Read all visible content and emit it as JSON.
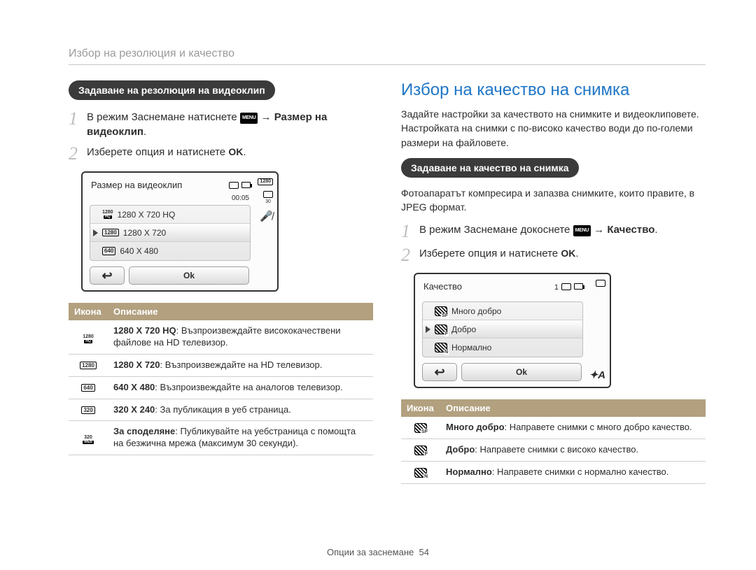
{
  "breadcrumb": "Избор на резолюция и качество",
  "left": {
    "pill": "Задаване на резолюция на видеоклип",
    "step1_pre": "В режим Заснемане натиснете ",
    "menu_badge": "MENU",
    "arrow": " → ",
    "step1_bold": "Размер на видеоклип",
    "step2_pre": "Изберете опция и натиснете ",
    "ok_glyph": "OK",
    "lcd": {
      "title": "Размер на видеоклип",
      "time": "00:05",
      "rows": [
        {
          "icon_top": "1280",
          "icon_sub": "HQ",
          "label": "1280 X 720 HQ"
        },
        {
          "icon_box": "1280",
          "label": "1280 X 720",
          "selected": true
        },
        {
          "icon_box": "640",
          "label": "640 X 480"
        }
      ],
      "back": "↩",
      "ok": "Ok"
    },
    "table": {
      "h1": "Икона",
      "h2": "Описание",
      "rows": [
        {
          "icon_top": "1280",
          "icon_sub": "HQ",
          "bold": "1280 X 720 HQ",
          "rest": ": Възпроизвеждайте висококачествени файлове на HD телевизор."
        },
        {
          "icon_box": "1280",
          "bold": "1280 X 720",
          "rest": ": Възпроизвеждайте на HD телевизор."
        },
        {
          "icon_box": "640",
          "bold": "640 X 480",
          "rest": ": Възпроизвеждайте на аналогов телевизор."
        },
        {
          "icon_box": "320",
          "bold": "320 X 240",
          "rest": ": За публикация в уеб страница."
        },
        {
          "icon_top": "320",
          "icon_sub": "WEB",
          "bold": "За споделяне",
          "rest": ": Публикувайте на уебстраница с помощта на безжична мрежа (максимум 30 секунди)."
        }
      ]
    }
  },
  "right": {
    "heading": "Избор на качество на снимка",
    "intro": "Задайте настройки за качеството на снимките и видеоклиповете. Настройката на снимки с по-високо качество води до по-големи размери на файловете.",
    "pill": "Задаване на качество на снимка",
    "compress": "Фотоапаратът компресира и запазва снимките, които правите, в JPEG формат.",
    "step1_pre": "В режим Заснемане докоснете ",
    "menu_badge": "MENU",
    "arrow": " → ",
    "step1_bold": "Качество",
    "step2_pre": "Изберете опция и натиснете ",
    "ok_glyph": "OK",
    "lcd": {
      "title": "Качество",
      "count": "1",
      "rows": [
        {
          "sub": "SF",
          "label": "Много добро"
        },
        {
          "sub": "F",
          "label": "Добро",
          "selected": true
        },
        {
          "sub": "N",
          "label": "Нормално"
        }
      ],
      "back": "↩",
      "ok": "Ok",
      "flash": "✦A"
    },
    "table": {
      "h1": "Икона",
      "h2": "Описание",
      "rows": [
        {
          "sub": "SF",
          "bold": "Много добро",
          "rest": ": Направете снимки с много добро качество."
        },
        {
          "sub": "F",
          "bold": "Добро",
          "rest": ": Направете снимки с високо качество."
        },
        {
          "sub": "N",
          "bold": "Нормално",
          "rest": ": Направете снимки с нормално качество."
        }
      ]
    }
  },
  "footer_label": "Опции за заснемане",
  "footer_page": "54"
}
